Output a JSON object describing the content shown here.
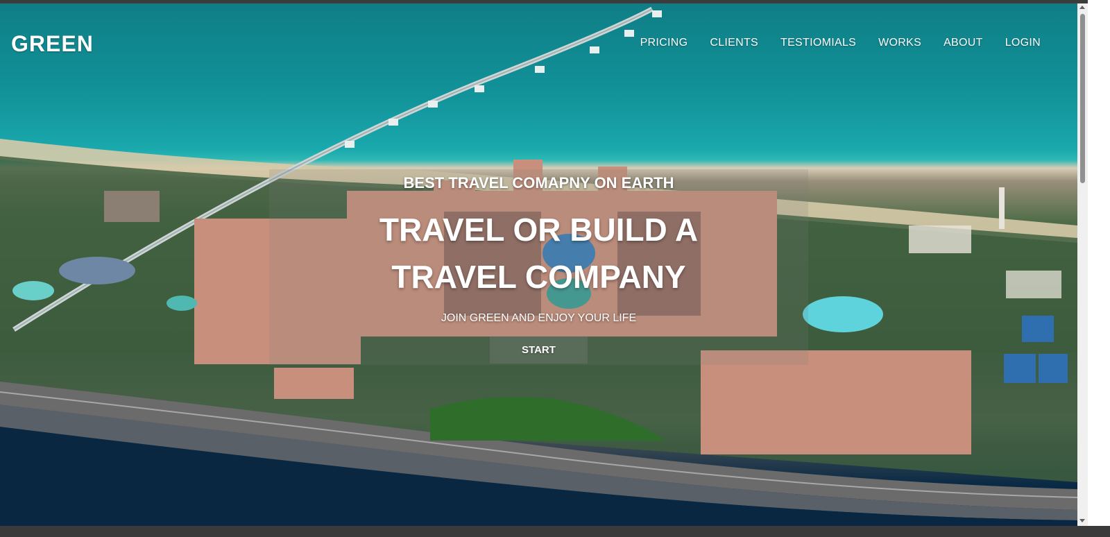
{
  "brand": {
    "logo": "GREEN"
  },
  "nav": {
    "items": [
      {
        "label": "PRICING"
      },
      {
        "label": "CLIENTS"
      },
      {
        "label": "TESTIOMIALS"
      },
      {
        "label": "WORKS"
      },
      {
        "label": "ABOUT"
      },
      {
        "label": "LOGIN"
      }
    ]
  },
  "hero": {
    "tagline": "BEST TRAVEL COMAPNY ON EARTH",
    "headline": "TRAVEL OR BUILD A TRAVEL COMPANY",
    "subtitle": "JOIN GREEN AND ENJOY YOUR LIFE",
    "cta_label": "START",
    "background_image": "aerial-resort-photo"
  },
  "colors": {
    "text": "#ffffff",
    "sea": "#129aa0"
  }
}
